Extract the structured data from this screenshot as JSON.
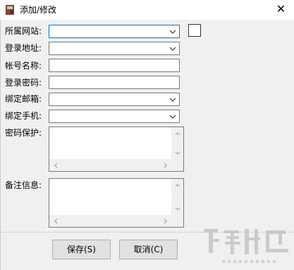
{
  "window": {
    "title": "添加/修改",
    "close_glyph": "✕"
  },
  "form": {
    "site_label": "所属网站:",
    "site_value": "",
    "login_url_label": "登录地址:",
    "login_url_value": "",
    "account_label": "帐号名称:",
    "account_value": "",
    "password_label": "登录密码:",
    "password_value": "",
    "bound_email_label": "绑定邮箱:",
    "bound_email_value": "",
    "bound_phone_label": "绑定手机:",
    "bound_phone_value": "",
    "password_protect_label": "密码保护:",
    "password_protect_value": "",
    "notes_label": "备注信息:",
    "notes_value": ""
  },
  "buttons": {
    "save_label": "保存(S)",
    "cancel_label": "取消(C)"
  },
  "icons": {
    "app": "app-icon",
    "dropdown": "chevron-down-icon",
    "scroll_up": "caret-up-icon",
    "scroll_down": "caret-down-icon",
    "scroll_left": "caret-left-icon",
    "scroll_right": "caret-right-icon"
  },
  "colors": {
    "focus_border": "#0078d7",
    "window_bg": "#f0f0f0",
    "field_bg": "#ffffff",
    "button_bg": "#e1e1e1"
  }
}
